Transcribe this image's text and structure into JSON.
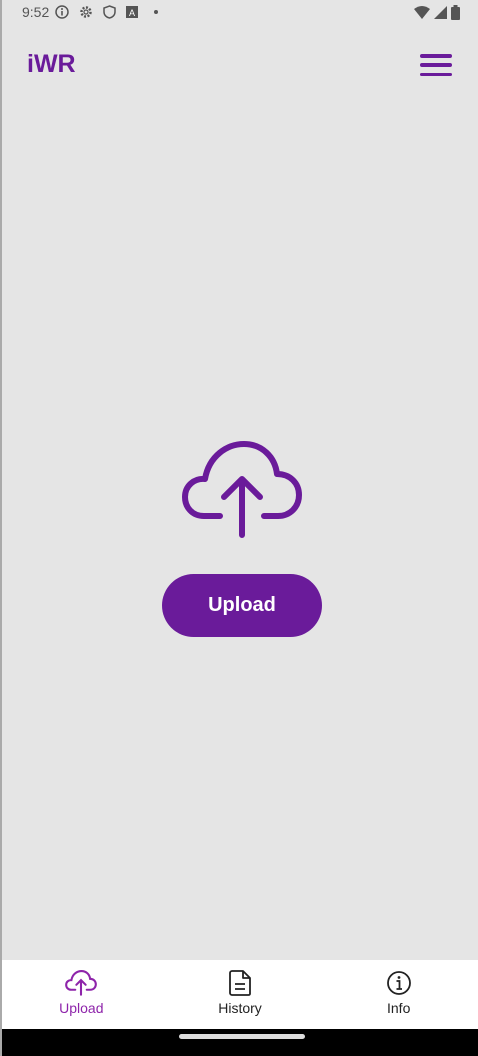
{
  "status_bar": {
    "time": "9:52"
  },
  "header": {
    "title": "iWR"
  },
  "main": {
    "upload_label": "Upload"
  },
  "nav": {
    "items": [
      {
        "label": "Upload"
      },
      {
        "label": "History"
      },
      {
        "label": "Info"
      }
    ]
  },
  "colors": {
    "accent": "#6a1b9a",
    "active_tab": "#8e24aa"
  }
}
